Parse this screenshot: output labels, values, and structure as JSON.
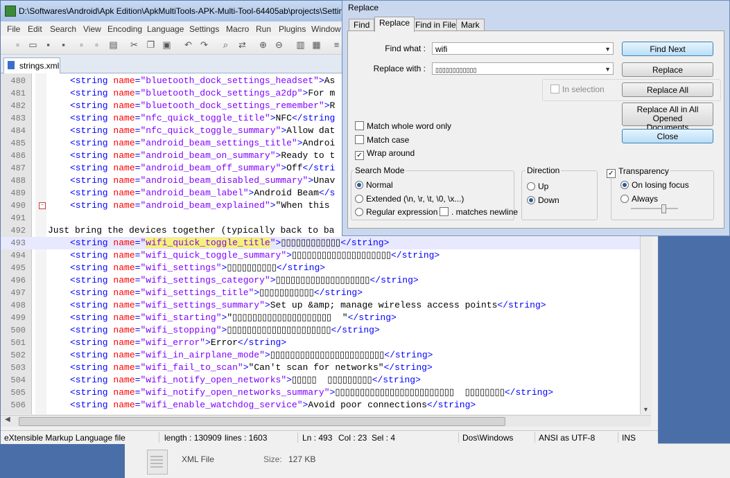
{
  "npp": {
    "title": "D:\\Softwares\\Android\\Apk Edition\\ApkMultiTools-APK-Multi-Tool-64405ab\\projects\\Settings",
    "menu": [
      "File",
      "Edit",
      "Search",
      "View",
      "Encoding",
      "Language",
      "Settings",
      "Macro",
      "Run",
      "Plugins",
      "Window"
    ],
    "tab": "strings.xml",
    "lines": [
      {
        "n": "480",
        "attr": "bluetooth_dock_settings_headset",
        "text": "As"
      },
      {
        "n": "481",
        "attr": "bluetooth_dock_settings_a2dp",
        "text": "For m"
      },
      {
        "n": "482",
        "attr": "bluetooth_dock_settings_remember",
        "text": "R"
      },
      {
        "n": "483",
        "attr": "nfc_quick_toggle_title",
        "text": "NFC",
        "close": "</string"
      },
      {
        "n": "484",
        "attr": "nfc_quick_toggle_summary",
        "text": "Allow dat"
      },
      {
        "n": "485",
        "attr": "android_beam_settings_title",
        "text": "Androi"
      },
      {
        "n": "486",
        "attr": "android_beam_on_summary",
        "text": "Ready to t"
      },
      {
        "n": "487",
        "attr": "android_beam_off_summary",
        "text": "Off",
        "close": "</stri"
      },
      {
        "n": "488",
        "attr": "android_beam_disabled_summary",
        "text": "Unav"
      },
      {
        "n": "489",
        "attr": "android_beam_label",
        "text": "Android Beam",
        "close": "</s"
      },
      {
        "n": "490",
        "attr": "android_beam_explained",
        "text": "\"When this"
      },
      {
        "n": "491"
      },
      {
        "n": "492",
        "plain": "Just bring the devices together (typically back to ba"
      },
      {
        "n": "493",
        "attr": "wifi_quick_toggle_title",
        "text": "▯▯▯▯▯▯▯▯▯▯▯▯",
        "close": "</string>",
        "cur": true
      },
      {
        "n": "494",
        "attr": "wifi_quick_toggle_summary",
        "text": "▯▯▯▯▯▯▯▯▯▯▯▯▯▯▯▯▯▯▯▯",
        "close": "</string>"
      },
      {
        "n": "495",
        "attr": "wifi_settings",
        "text": "▯▯▯▯▯▯▯▯▯▯",
        "close": "</string>"
      },
      {
        "n": "496",
        "attr": "wifi_settings_category",
        "text": "▯▯▯▯▯▯▯▯▯▯▯▯▯▯▯▯▯▯▯",
        "close": "</string>"
      },
      {
        "n": "497",
        "attr": "wifi_settings_title",
        "text": "▯▯▯▯▯▯▯▯▯▯▯",
        "close": "</string>"
      },
      {
        "n": "498",
        "attr": "wifi_settings_summary",
        "text": "Set up &amp; manage wireless access points",
        "close": "</string>"
      },
      {
        "n": "499",
        "attr": "wifi_starting",
        "text": "\"▯▯▯▯▯▯▯▯▯▯▯▯▯▯▯▯▯▯▯▯  \"",
        "close": "</string>"
      },
      {
        "n": "500",
        "attr": "wifi_stopping",
        "text": "▯▯▯▯▯▯▯▯▯▯▯▯▯▯▯▯▯▯▯▯▯",
        "close": "</string>"
      },
      {
        "n": "501",
        "attr": "wifi_error",
        "text": "Error",
        "close": "</string>"
      },
      {
        "n": "502",
        "attr": "wifi_in_airplane_mode",
        "text": "▯▯▯▯▯▯▯▯▯▯▯▯▯▯▯▯▯▯▯▯▯▯▯",
        "close": "</string>"
      },
      {
        "n": "503",
        "attr": "wifi_fail_to_scan",
        "text": "\"Can't scan for networks\"",
        "close": "</string>"
      },
      {
        "n": "504",
        "attr": "wifi_notify_open_networks",
        "text": "▯▯▯▯▯  ▯▯▯▯▯▯▯▯▯",
        "close": "</string>"
      },
      {
        "n": "505",
        "attr": "wifi_notify_open_networks_summary",
        "text": "▯▯▯▯▯▯▯▯▯▯▯▯▯▯▯▯▯▯▯▯▯▯▯▯  ▯▯▯▯▯▯▯▯",
        "close": "</string>"
      },
      {
        "n": "506",
        "attr": "wifi_enable_watchdog_service",
        "text": "Avoid poor connections",
        "close": "</string>"
      }
    ],
    "status": {
      "type": "eXtensible Markup Language file",
      "length": "length : 130909",
      "lines": "lines : 1603",
      "ln": "Ln : 493",
      "col": "Col : 23",
      "sel": "Sel : 4",
      "eol": "Dos\\Windows",
      "enc": "ANSI as UTF-8",
      "ins": "INS"
    }
  },
  "explorer": {
    "type": "XML File",
    "size_label": "Size:",
    "size": "127 KB"
  },
  "dialog": {
    "title": "Replace",
    "tabs": [
      "Find",
      "Replace",
      "Find in Files",
      "Mark"
    ],
    "find_label": "Find what :",
    "find_value": "wifi",
    "replace_label": "Replace with :",
    "replace_value": "▯▯▯▯▯▯▯▯▯▯▯▯",
    "buttons": {
      "find_next": "Find Next",
      "replace": "Replace",
      "replace_all": "Replace All",
      "replace_all_docs_1": "Replace All in All Opened",
      "replace_all_docs_2": "Documents",
      "close": "Close"
    },
    "in_selection": "In selection",
    "options": {
      "whole_word": "Match whole word only",
      "match_case": "Match case",
      "wrap": "Wrap around"
    },
    "search_mode": {
      "label": "Search Mode",
      "normal": "Normal",
      "extended": "Extended (\\n, \\r, \\t, \\0, \\x...)",
      "regex": "Regular expression",
      "newline": ". matches newline"
    },
    "direction": {
      "label": "Direction",
      "up": "Up",
      "down": "Down"
    },
    "transparency": {
      "label": "Transparency",
      "losing_focus": "On losing focus",
      "always": "Always"
    }
  }
}
